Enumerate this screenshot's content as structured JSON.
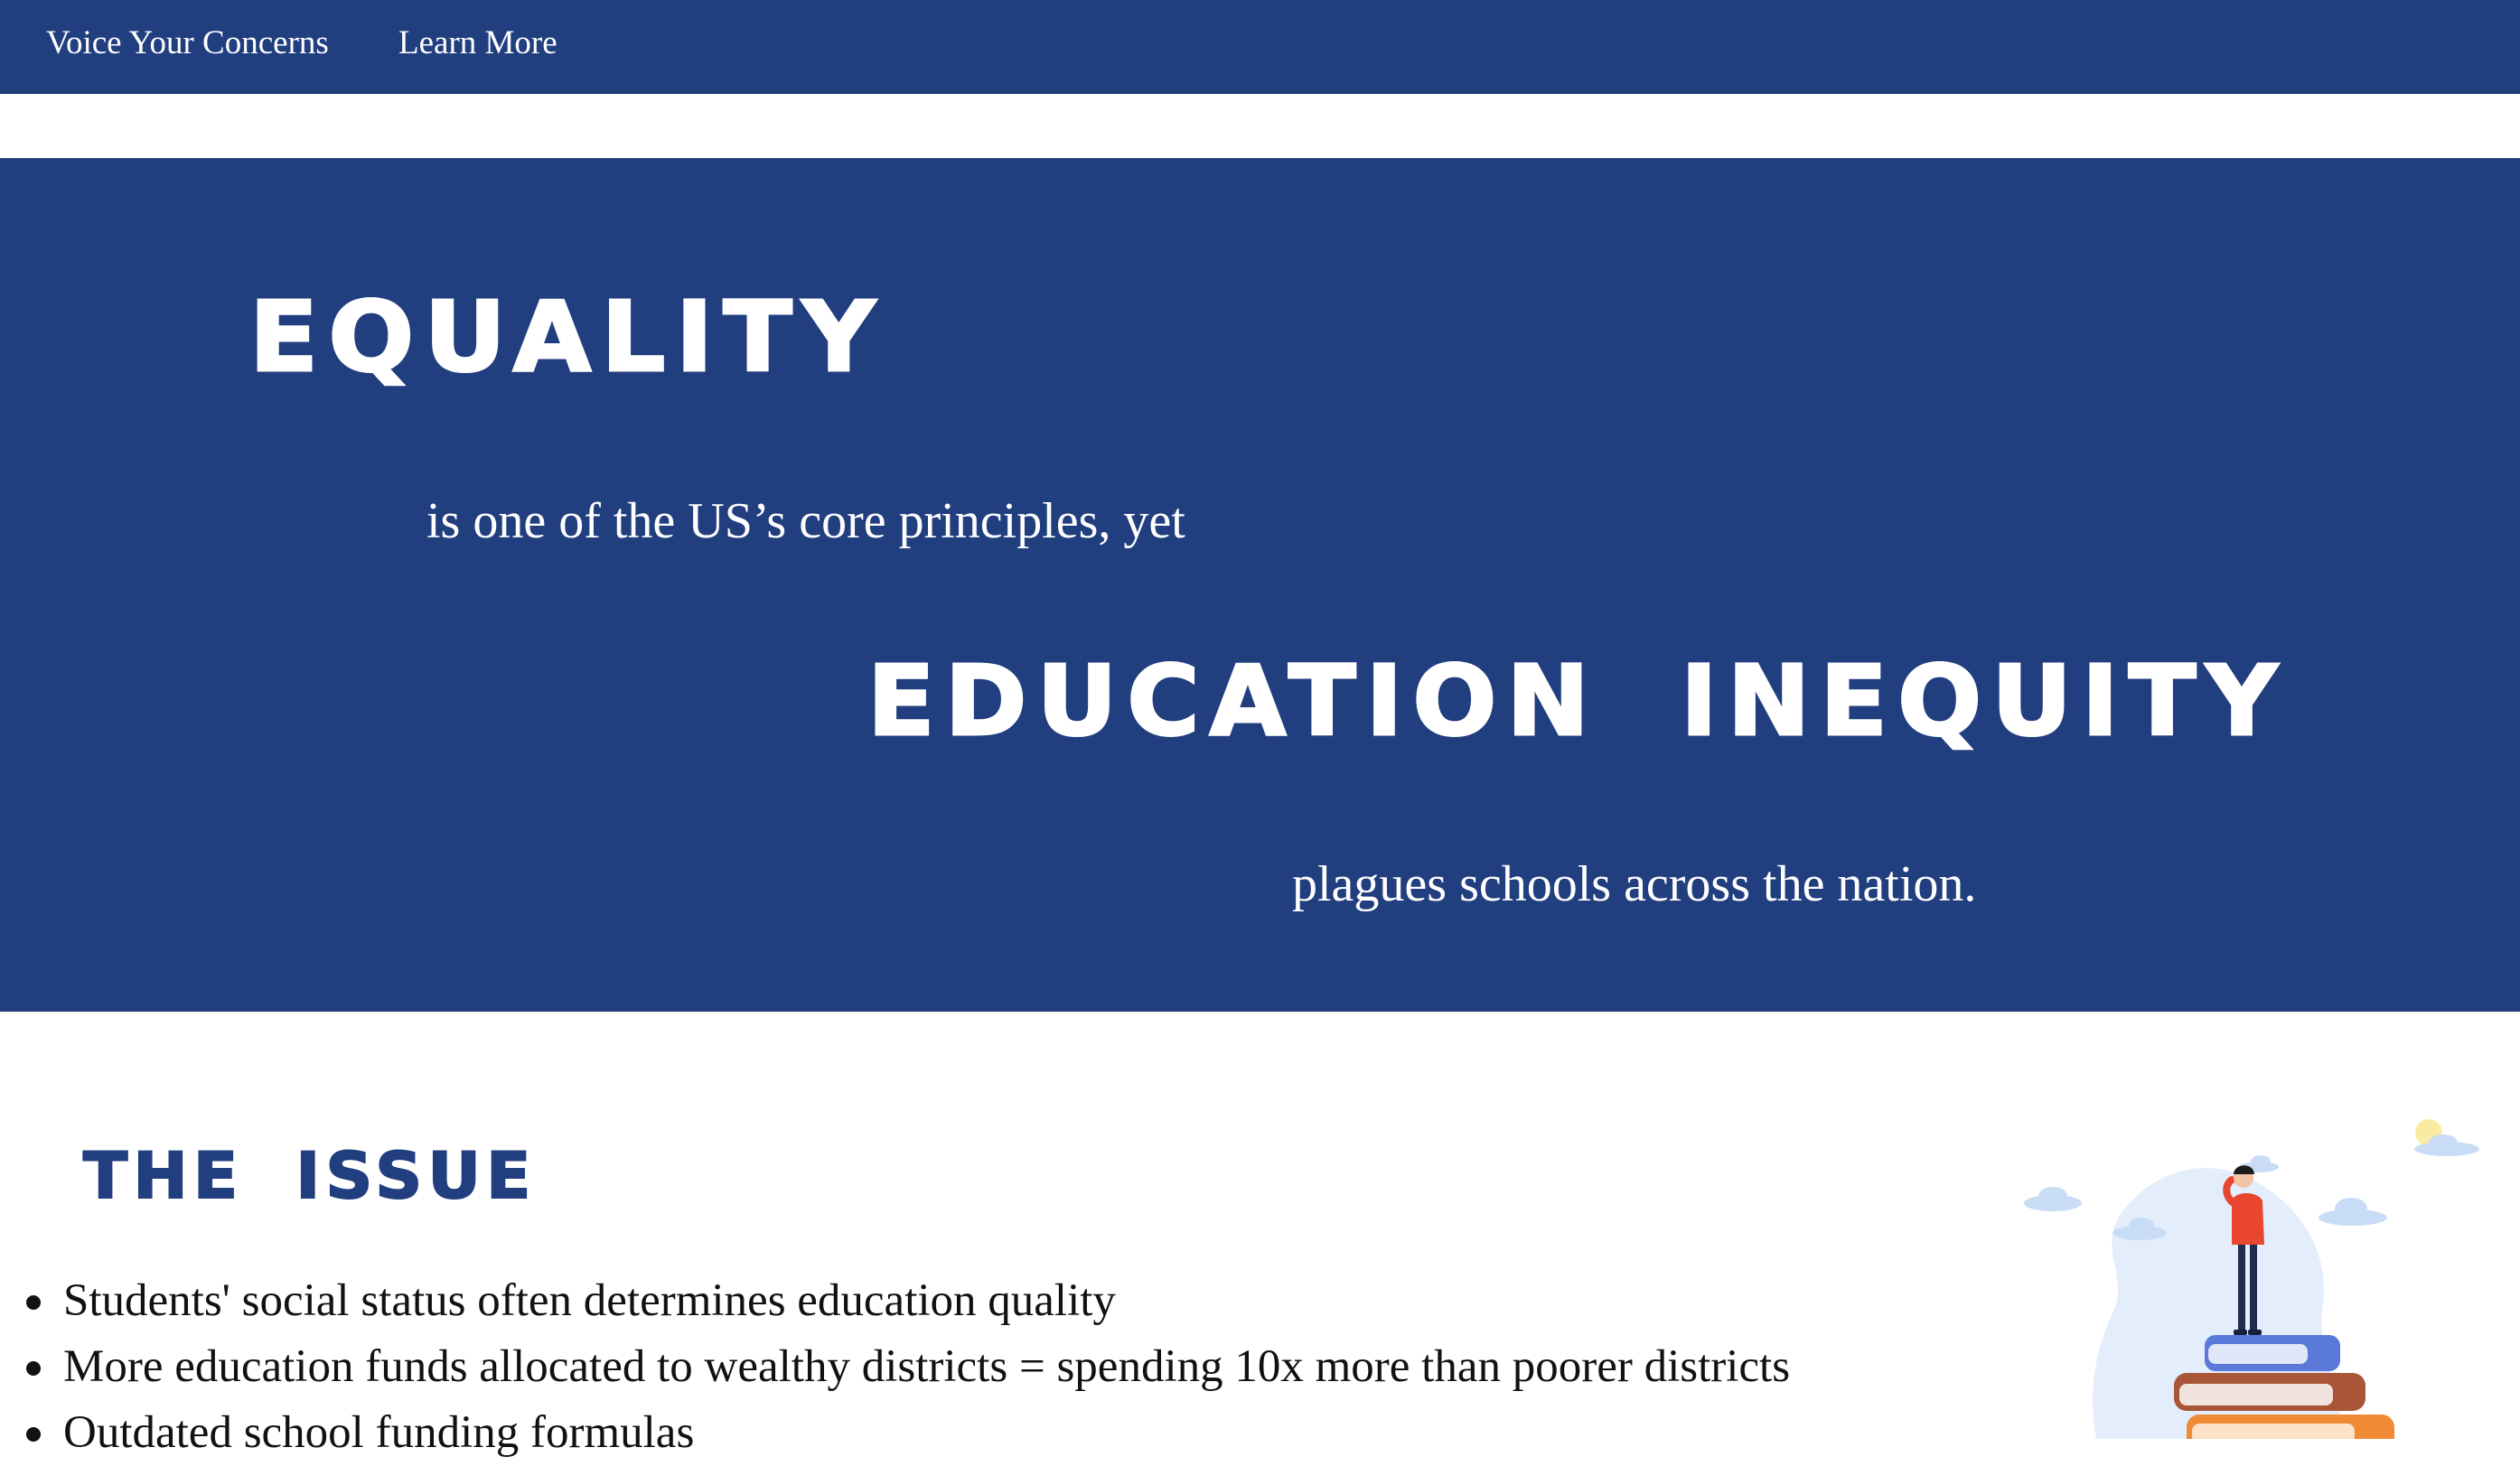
{
  "nav": {
    "voice_label": "Voice Your Concerns",
    "learn_label": "Learn More"
  },
  "hero": {
    "equality": "EQUALITY",
    "core_principles": "is one of the US’s core principles, yet",
    "inequity": "EDUCATION INEQUITY",
    "plagues": "plagues schools across the nation."
  },
  "issue": {
    "title": "THE ISSUE",
    "items": [
      "Students' social status often determines education quality",
      "More education funds allocated to wealthy districts = spending 10x more than poorer districts",
      "Outdated school funding formulas"
    ]
  },
  "illustration": {
    "icon": "person-on-books-illustration",
    "colors": {
      "blob": "#e3edfb",
      "cloud": "#c9dcf5",
      "sun": "#fbeaa2",
      "book_blue": "#5b79d8",
      "book_brown": "#a85538",
      "book_orange": "#f08a35",
      "shirt": "#e8462f",
      "pants": "#1f2d4d"
    }
  }
}
